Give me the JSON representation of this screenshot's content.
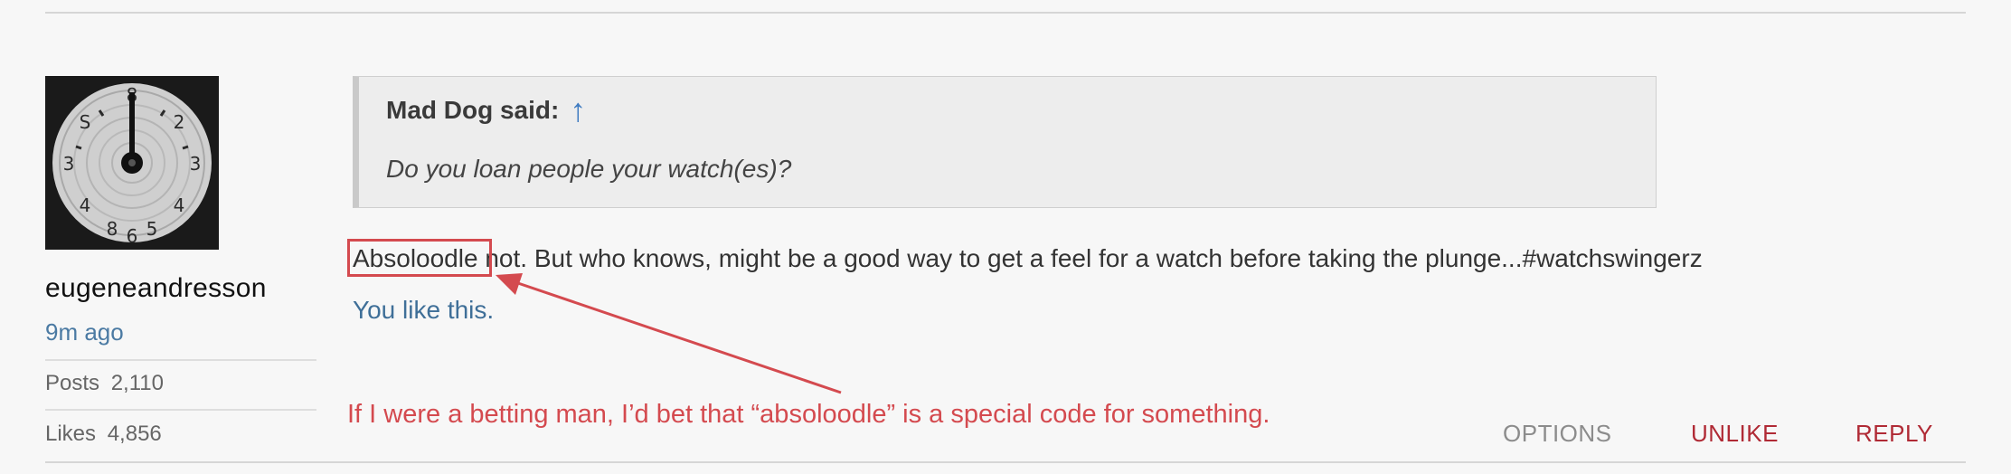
{
  "post": {
    "user": {
      "name": "eugeneandresson",
      "time": "9m ago",
      "stats": [
        {
          "label": "Posts",
          "value": "2,110"
        },
        {
          "label": "Likes",
          "value": "4,856"
        }
      ]
    },
    "quote": {
      "author": "Mad Dog said:",
      "arrow": "↑",
      "text": "Do you loan people your watch(es)?"
    },
    "message": {
      "highlighted_word": "Absoloodle",
      "rest": " not. But who knows, might be a good way to get a feel for a watch before taking the plunge...#watchswingerz"
    },
    "likes_text": "You like this.",
    "actions": {
      "options": "OPTIONS",
      "unlike": "UNLIKE",
      "reply": "REPLY"
    }
  },
  "annotation": {
    "text": "If I were a betting man, I’d bet that “absoloodle” is a special code for something.",
    "color": "#d44a4f"
  },
  "colors": {
    "link_blue": "#4b7aa3",
    "action_red": "#b02a35",
    "annotation_red": "#d44a4f"
  }
}
